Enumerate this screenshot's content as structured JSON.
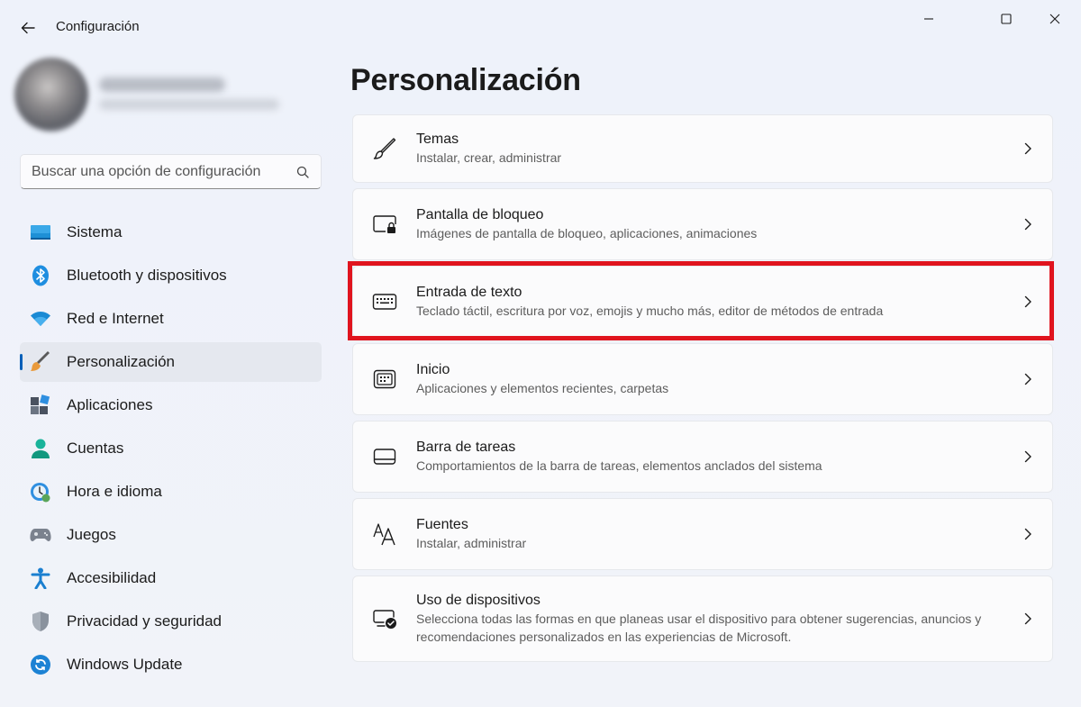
{
  "window": {
    "title": "Configuración"
  },
  "search": {
    "placeholder": "Buscar una opción de configuración"
  },
  "nav": {
    "items": [
      {
        "label": "Sistema",
        "icon": "system-icon"
      },
      {
        "label": "Bluetooth y dispositivos",
        "icon": "bluetooth-icon"
      },
      {
        "label": "Red e Internet",
        "icon": "wifi-icon"
      },
      {
        "label": "Personalización",
        "icon": "brush-icon",
        "active": true
      },
      {
        "label": "Aplicaciones",
        "icon": "apps-icon"
      },
      {
        "label": "Cuentas",
        "icon": "account-icon"
      },
      {
        "label": "Hora e idioma",
        "icon": "clock-globe-icon"
      },
      {
        "label": "Juegos",
        "icon": "gamepad-icon"
      },
      {
        "label": "Accesibilidad",
        "icon": "accessibility-icon"
      },
      {
        "label": "Privacidad y seguridad",
        "icon": "shield-icon"
      },
      {
        "label": "Windows Update",
        "icon": "update-icon"
      }
    ]
  },
  "main": {
    "title": "Personalización",
    "cards": [
      {
        "title": "Temas",
        "subtitle": "Instalar, crear, administrar",
        "icon": "pen-icon"
      },
      {
        "title": "Pantalla de bloqueo",
        "subtitle": "Imágenes de pantalla de bloqueo, aplicaciones, animaciones",
        "icon": "lock-screen-icon"
      },
      {
        "title": "Entrada de texto",
        "subtitle": "Teclado táctil, escritura por voz, emojis y mucho más, editor de métodos de entrada",
        "icon": "keyboard-icon",
        "highlighted": true
      },
      {
        "title": "Inicio",
        "subtitle": "Aplicaciones y elementos recientes, carpetas",
        "icon": "start-icon"
      },
      {
        "title": "Barra de tareas",
        "subtitle": "Comportamientos de la barra de tareas, elementos anclados del sistema",
        "icon": "taskbar-icon"
      },
      {
        "title": "Fuentes",
        "subtitle": "Instalar, administrar",
        "icon": "fonts-icon"
      },
      {
        "title": "Uso de dispositivos",
        "subtitle": "Selecciona todas las formas en que planeas usar el dispositivo para obtener sugerencias, anuncios y recomendaciones personalizados en las experiencias de Microsoft.",
        "icon": "device-usage-icon"
      }
    ]
  },
  "colors": {
    "accent": "#005fb8",
    "highlight": "#e0141e"
  }
}
